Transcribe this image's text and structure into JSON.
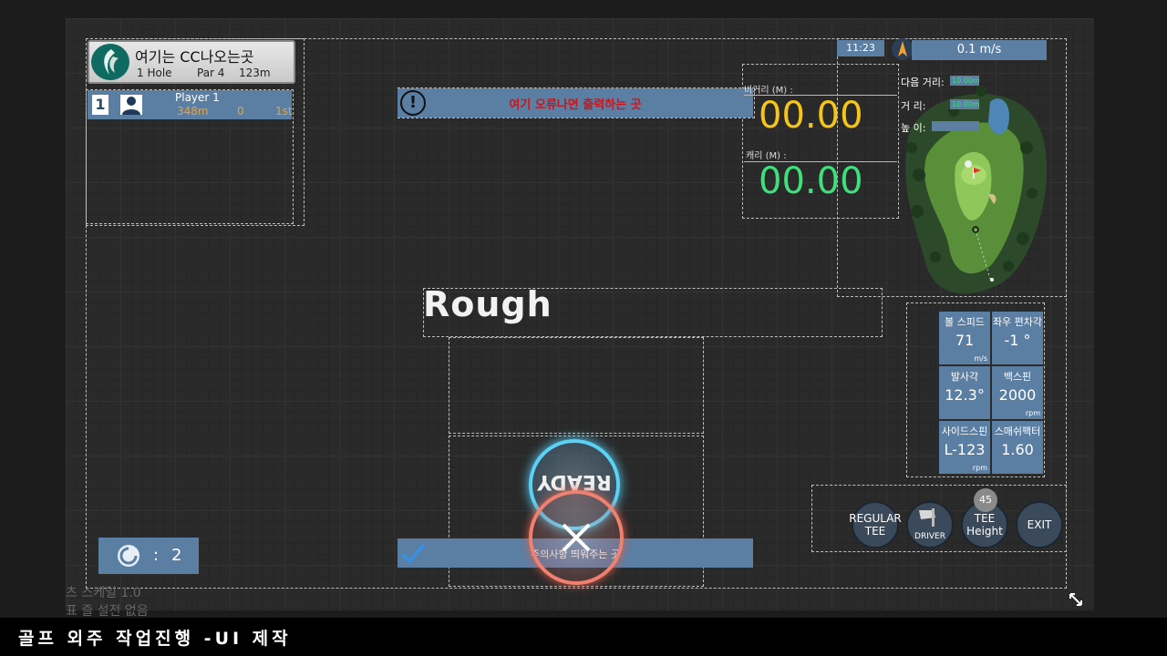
{
  "header": {
    "course_name": "여기는 CC나오는곳",
    "hole": "1 Hole",
    "par": "Par 4",
    "hole_length": "123m"
  },
  "player": {
    "number": "1",
    "name": "Player 1",
    "remaining": "348m",
    "strokes": "0",
    "rank": "1st"
  },
  "alert": {
    "icon": "exclamation-icon",
    "text": "여기 오류나면 출력하는 곳"
  },
  "status": {
    "time": "11:23",
    "wind": "0.1 m/s"
  },
  "distance": {
    "flight_label": "비거리 (M) :",
    "flight_value": "00.00",
    "carry_label": "캐리 (M) :",
    "carry_value": "00.00",
    "flight_color": "#f5c518",
    "carry_color": "#3de07a"
  },
  "map_info": {
    "next_label": "다음 거리:",
    "next_value": "10.00m",
    "dist_label": "거 리:",
    "dist_value": "10.00m",
    "height_label": "높 이:",
    "height_value": ""
  },
  "lie": "Rough",
  "shot_stats": [
    {
      "label": "볼 스피드",
      "value": "71",
      "unit": "m/s"
    },
    {
      "label": "좌우 편차각",
      "value": "-1 °",
      "unit": ""
    },
    {
      "label": "발사각",
      "value": "12.3°",
      "unit": ""
    },
    {
      "label": "백스핀",
      "value": "2000",
      "unit": "rpm"
    },
    {
      "label": "사이드스핀",
      "value": "L-123",
      "unit": "rpm"
    },
    {
      "label": "스매쉬팩터",
      "value": "1.60",
      "unit": ""
    }
  ],
  "buttons": {
    "regular_tee": "REGULAR TEE",
    "driver": "DRIVER",
    "tee_height": "TEE Height",
    "tee_height_value": "45",
    "exit": "EXIT"
  },
  "ready_label": "READY",
  "notice_text": "주의사항 띄워주는 곳",
  "ball_count": {
    "separator": ":",
    "value": "2"
  },
  "editor_overlay": {
    "line1": "츠 스케일 1.0",
    "line2": "표 즐 설전 없음"
  },
  "caption": "골프 외주 작업진행 -UI 제작"
}
